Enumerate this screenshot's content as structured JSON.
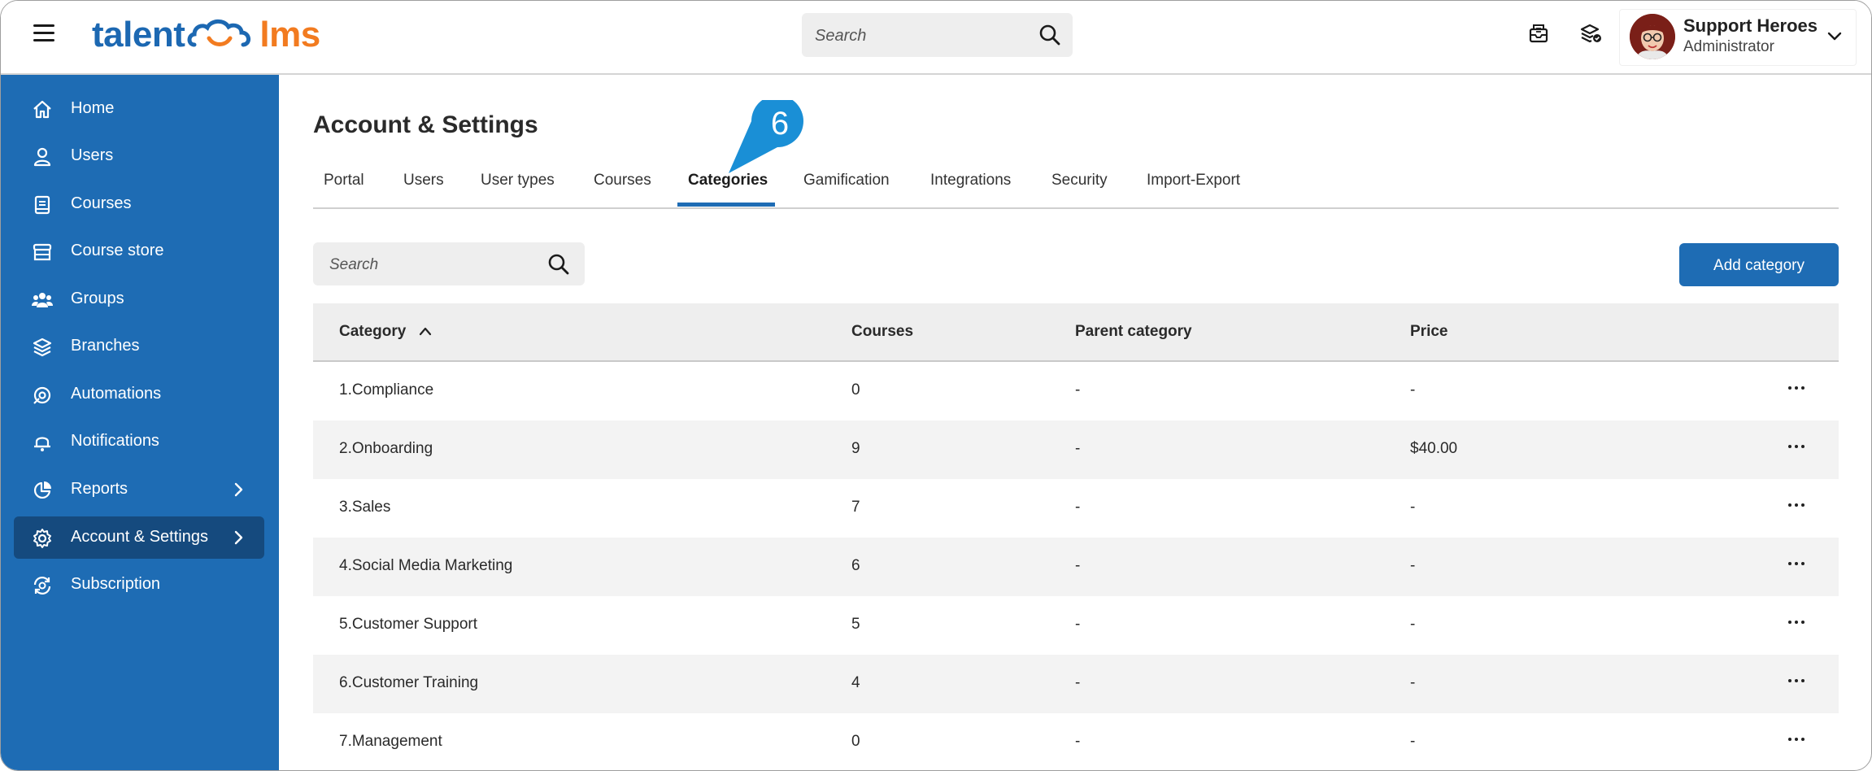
{
  "header": {
    "logo_talent": "talent",
    "logo_lms": "lms",
    "search_placeholder": "Search",
    "user_name": "Support Heroes",
    "user_role": "Administrator"
  },
  "sidebar": {
    "items": [
      {
        "label": "Home",
        "icon": "home-icon"
      },
      {
        "label": "Users",
        "icon": "user-icon"
      },
      {
        "label": "Courses",
        "icon": "book-icon"
      },
      {
        "label": "Course store",
        "icon": "store-icon"
      },
      {
        "label": "Groups",
        "icon": "groups-icon"
      },
      {
        "label": "Branches",
        "icon": "layers-icon"
      },
      {
        "label": "Automations",
        "icon": "automation-icon"
      },
      {
        "label": "Notifications",
        "icon": "bell-icon"
      },
      {
        "label": "Reports",
        "icon": "pie-chart-icon"
      },
      {
        "label": "Account & Settings",
        "icon": "gear-icon"
      },
      {
        "label": "Subscription",
        "icon": "subscription-icon"
      }
    ]
  },
  "main": {
    "title": "Account & Settings",
    "tabs": [
      "Portal",
      "Users",
      "User types",
      "Courses",
      "Categories",
      "Gamification",
      "Integrations",
      "Security",
      "Import-Export"
    ],
    "active_tab": "Categories",
    "callout_number": "6",
    "search_placeholder": "Search",
    "add_button": "Add category",
    "columns": [
      "Category",
      "Courses",
      "Parent category",
      "Price"
    ],
    "rows": [
      {
        "category": "1.Compliance",
        "courses": "0",
        "parent": "-",
        "price": "-"
      },
      {
        "category": "2.Onboarding",
        "courses": "9",
        "parent": "-",
        "price": "$40.00"
      },
      {
        "category": "3.Sales",
        "courses": "7",
        "parent": "-",
        "price": "-"
      },
      {
        "category": "4.Social Media Marketing",
        "courses": "6",
        "parent": "-",
        "price": "-"
      },
      {
        "category": "5.Customer Support",
        "courses": "5",
        "parent": "-",
        "price": "-"
      },
      {
        "category": "6.Customer Training",
        "courses": "4",
        "parent": "-",
        "price": "-"
      },
      {
        "category": "7.Management",
        "courses": "0",
        "parent": "-",
        "price": "-"
      }
    ]
  },
  "colors": {
    "brand_blue": "#1e6cb4",
    "sidebar_active": "#154a7e",
    "logo_orange": "#f27b20",
    "callout": "#1a8fd6"
  }
}
